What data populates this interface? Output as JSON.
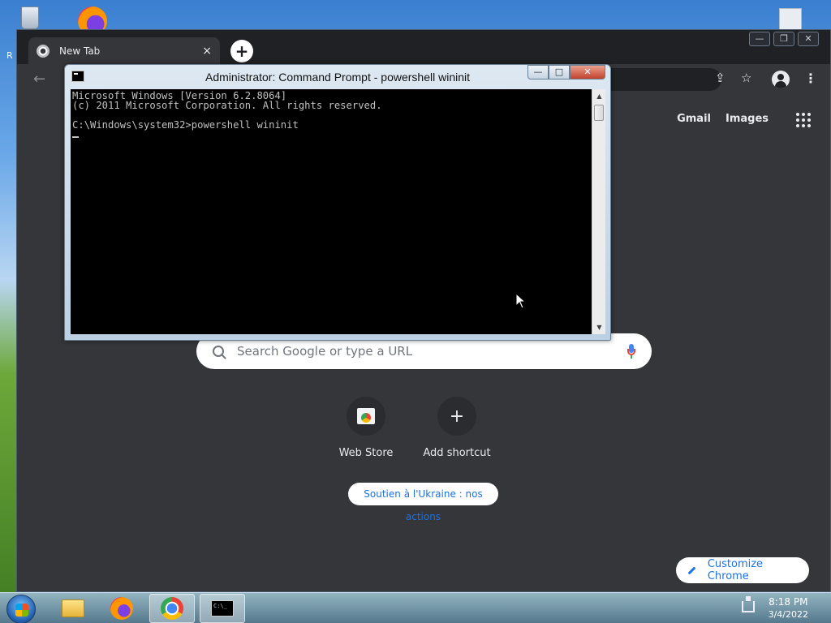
{
  "desktop": {
    "left_label": "R"
  },
  "chrome": {
    "tab_title": "New Tab",
    "tab_close": "×",
    "new_tab": "+",
    "window_controls": {
      "minimize": "—",
      "maximize": "❐",
      "close": "✕"
    },
    "back": "←",
    "toolbar_icons": {
      "share": "⇪",
      "star": "☆",
      "menu": "⋮"
    },
    "top_links": {
      "gmail": "Gmail",
      "images": "Images"
    },
    "search_placeholder": "Search Google or type a URL",
    "shortcuts": [
      {
        "label": "Web Store"
      },
      {
        "label": "Add shortcut",
        "symbol": "+"
      }
    ],
    "ukraine_pill": "Soutien à l'Ukraine : nos actions",
    "customize_label": "Customize Chrome"
  },
  "cmd": {
    "title": "Administrator: Command Prompt - powershell  wininit",
    "controls": {
      "minimize": "—",
      "maximize": "□",
      "close": "✕"
    },
    "lines": {
      "line1": "Microsoft Windows [Version 6.2.8064]",
      "line2": "(c) 2011 Microsoft Corporation. All rights reserved.",
      "line3": "",
      "line4": "C:\\Windows\\system32>powershell wininit"
    },
    "scroll_up": "▲",
    "scroll_down": "▼"
  },
  "taskbar": {
    "cmd_icon_text": "C:\\_",
    "clock_time": "8:18 PM",
    "clock_date": "3/4/2022"
  }
}
